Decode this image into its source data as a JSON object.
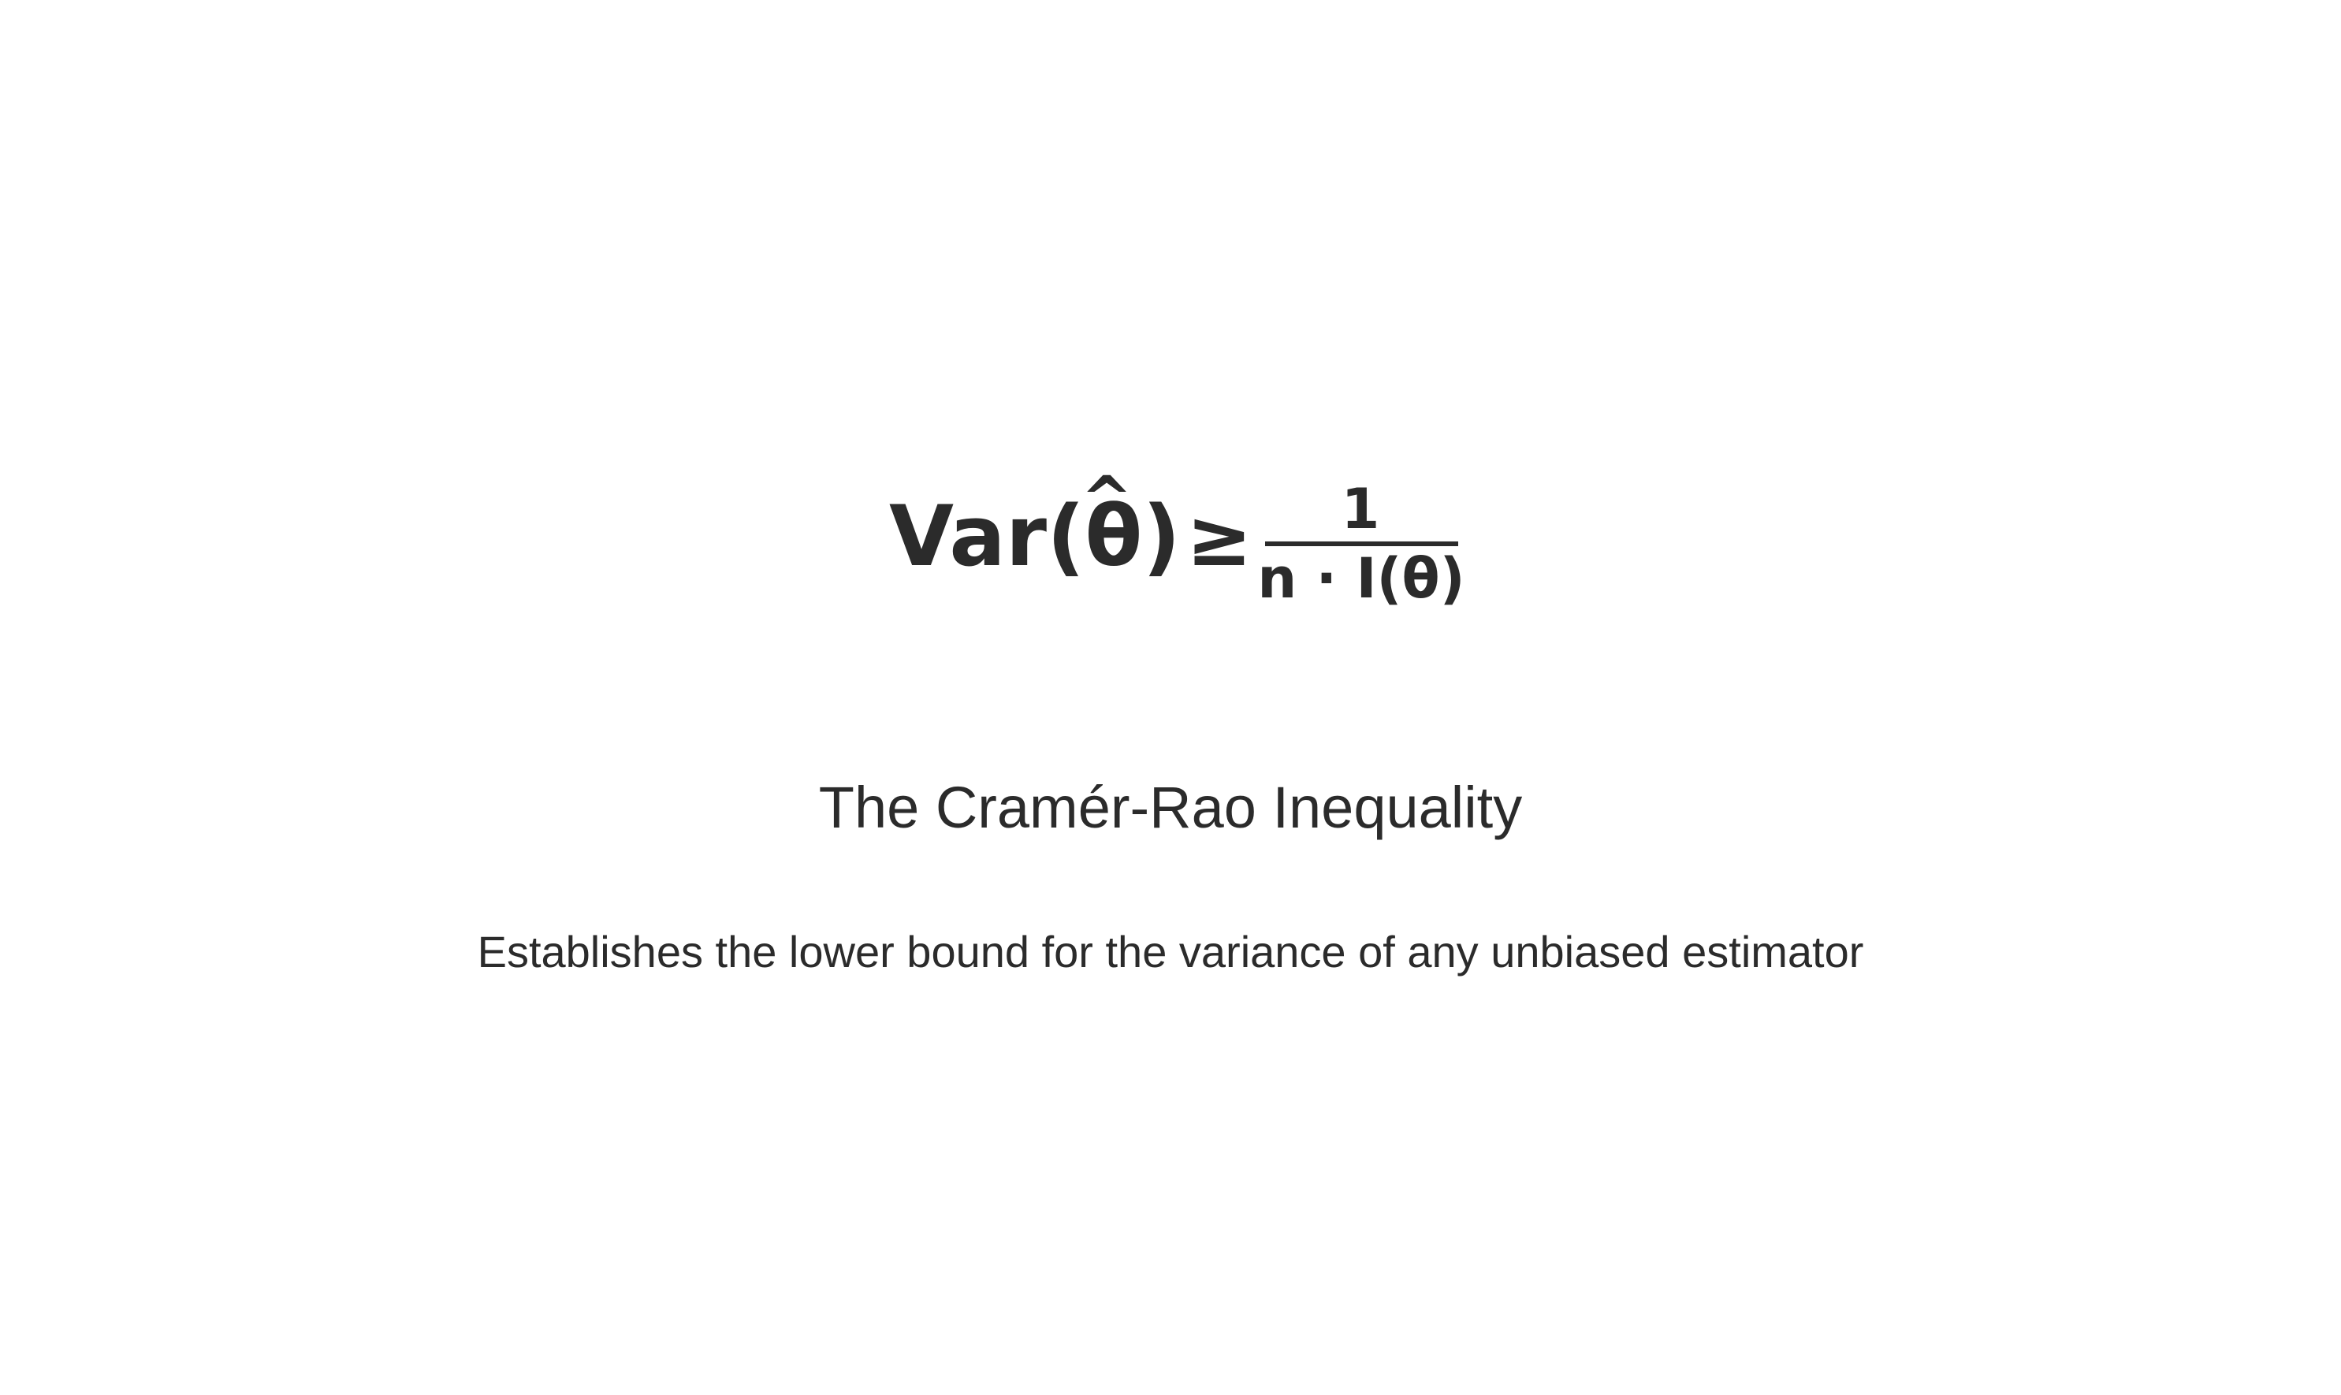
{
  "formula": {
    "lhs": "Var(θ)",
    "hat": "^",
    "relation": "≥",
    "numerator": "1",
    "denominator": "n · I(θ)"
  },
  "heading": "The Cramér-Rao Inequality",
  "description": "Establishes the lower bound for the variance of any unbiased estimator",
  "colors": {
    "text": "#2b2b2b",
    "background": "#ffffff"
  }
}
